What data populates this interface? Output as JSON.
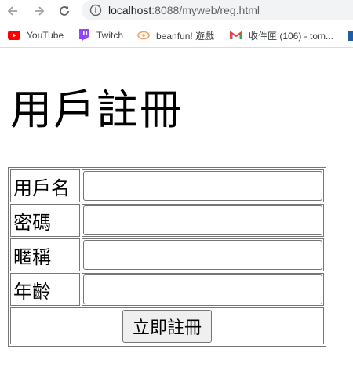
{
  "browser": {
    "url_host": "localhost",
    "url_path": ":8088/myweb/reg.html",
    "bookmarks": [
      {
        "label": "YouTube",
        "icon": "youtube-icon",
        "color": "#ff0000"
      },
      {
        "label": "Twitch",
        "icon": "twitch-icon",
        "color": "#9146ff"
      },
      {
        "label": "beanfun! 遊戲",
        "icon": "beanfun-icon",
        "color": "#f5a05a"
      },
      {
        "label": "收件匣 (106) - tom...",
        "icon": "gmail-icon",
        "color": "#ea4335"
      }
    ]
  },
  "page": {
    "title": "用戶註冊",
    "fields": [
      {
        "label": "用戶名",
        "value": ""
      },
      {
        "label": "密碼",
        "value": ""
      },
      {
        "label": "暱稱",
        "value": ""
      },
      {
        "label": "年齡",
        "value": ""
      }
    ],
    "submit_label": "立即註冊"
  }
}
